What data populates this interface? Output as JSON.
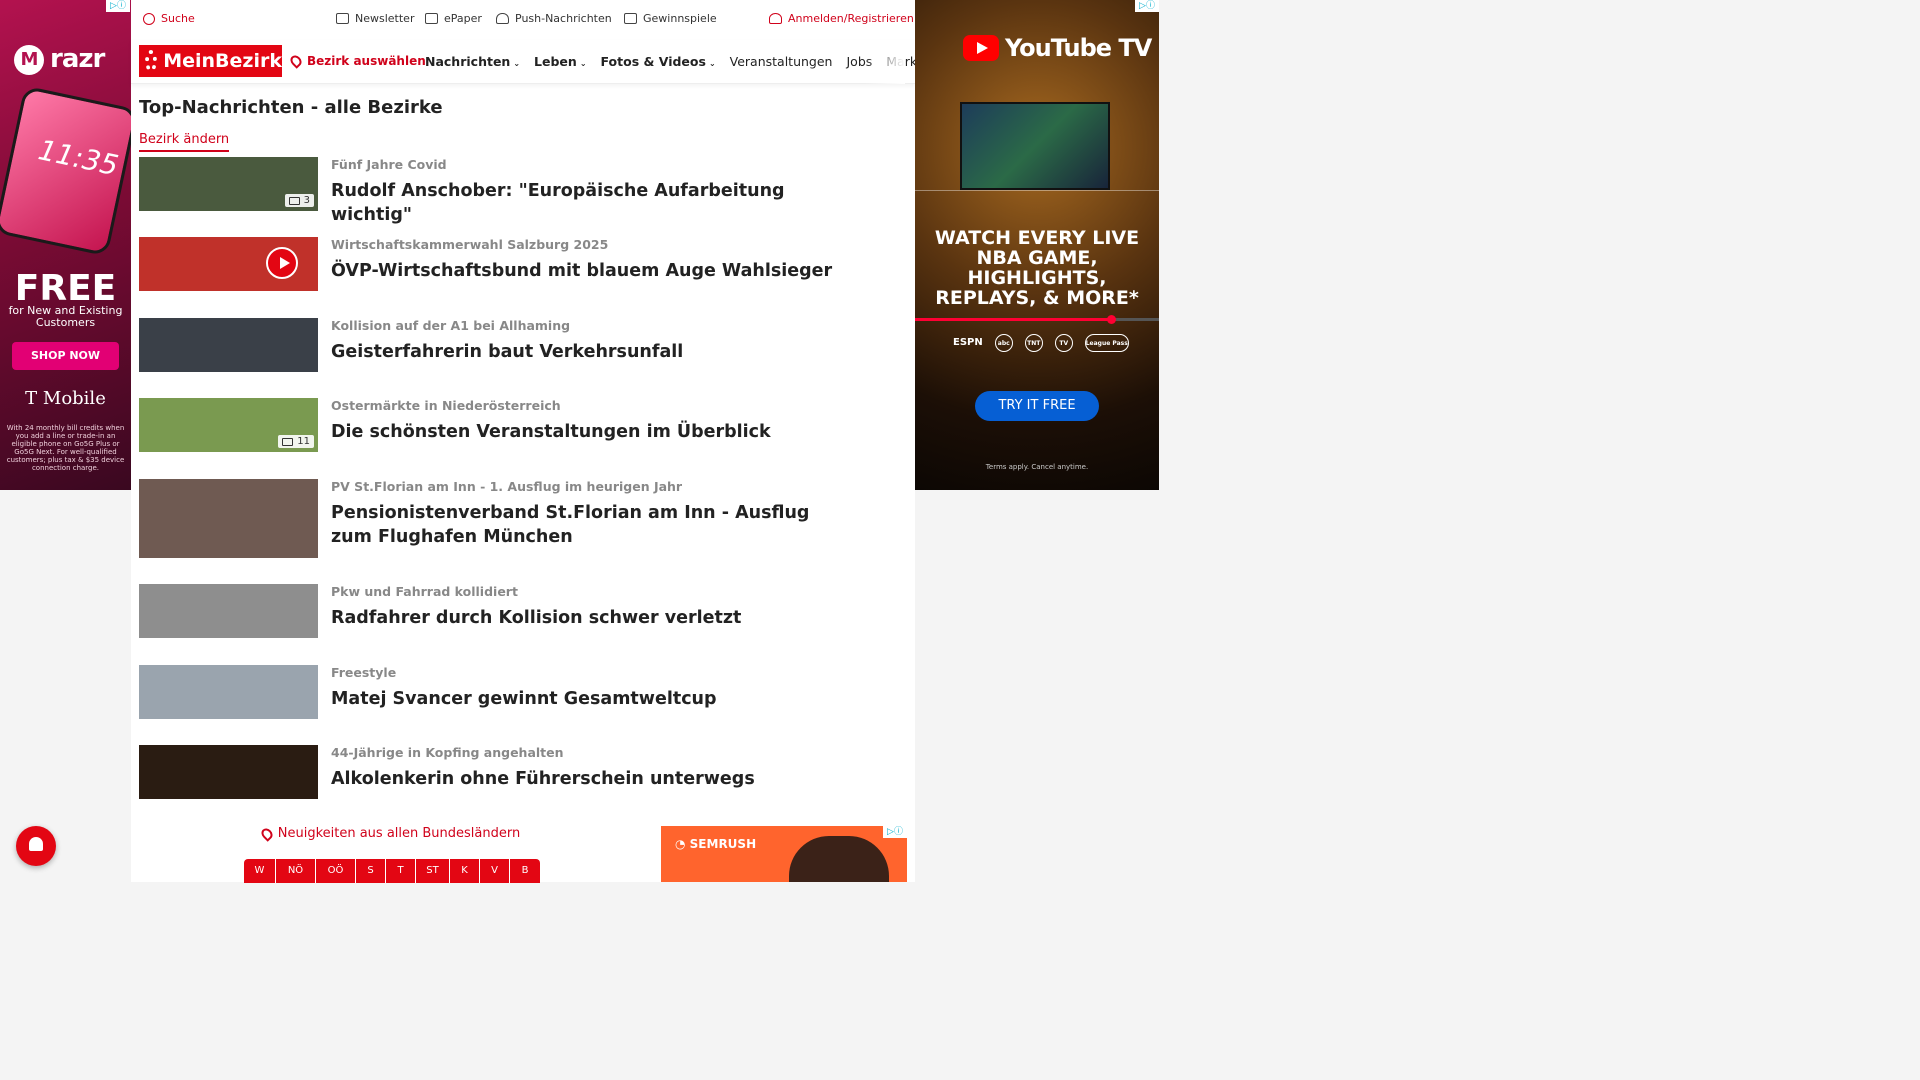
{
  "topbar": {
    "search": "Suche",
    "newsletter": "Newsletter",
    "epaper": "ePaper",
    "push": "Push-Nachrichten",
    "games": "Gewinnspiele",
    "login": "Anmelden/Registrieren"
  },
  "nav": {
    "logo": "MeinBezirk",
    "bezirk": "Bezirk auswählen",
    "links": [
      {
        "label": "Nachrichten",
        "dropdown": true
      },
      {
        "label": "Leben",
        "dropdown": true
      },
      {
        "label": "Fotos & Videos",
        "dropdown": true
      },
      {
        "label": "Veranstaltungen",
        "dropdown": false
      },
      {
        "label": "Jobs",
        "dropdown": false
      },
      {
        "label": "Marktplatz",
        "dropdown": false
      }
    ]
  },
  "main": {
    "heading": "Top-Nachrichten - alle Bezirke",
    "change_link": "Bezirk ändern",
    "articles": [
      {
        "overline": "Fünf Jahre Covid",
        "title": "Rudolf Anschober: \"Europäische Aufarbeitung wichtig\"",
        "media": "gallery",
        "count": "3",
        "thumb_color": "#4a5a3e"
      },
      {
        "overline": "Wirtschaftskammerwahl Salzburg 2025",
        "title": "ÖVP-Wirtschaftsbund mit blauem Auge Wahlsieger",
        "media": "video",
        "count": "",
        "thumb_color": "#c0312a"
      },
      {
        "overline": "Kollision auf der A1 bei Allhaming",
        "title": "Geisterfahrerin baut Verkehrsunfall",
        "media": "none",
        "count": "",
        "thumb_color": "#3a4048"
      },
      {
        "overline": "Ostermärkte in Niederösterreich",
        "title": "Die schönsten Veranstaltungen im Überblick",
        "media": "gallery",
        "count": "11",
        "thumb_color": "#7a9a50"
      },
      {
        "overline": "PV St.Florian am Inn - 1. Ausflug im heurigen Jahr",
        "title": "Pensionistenverband St.Florian am Inn - Ausflug zum Flughafen München",
        "media": "none",
        "count": "",
        "thumb_color": "#6f5a52"
      },
      {
        "overline": "Pkw und Fahrrad kollidiert",
        "title": "Radfahrer durch Kollision schwer verletzt",
        "media": "none",
        "count": "",
        "thumb_color": "#8e8e8e"
      },
      {
        "overline": "Freestyle",
        "title": "Matej Svancer gewinnt Gesamtweltcup",
        "media": "none",
        "count": "",
        "thumb_color": "#9aa4ae"
      },
      {
        "overline": "44-Jährige in Kopfing angehalten",
        "title": "Alkolenkerin ohne Führerschein unterwegs",
        "media": "none",
        "count": "",
        "thumb_color": "#2a1c12"
      }
    ],
    "bundeslaender_label": "Neuigkeiten aus allen Bundesländern",
    "states": [
      "W",
      "NÖ",
      "OÖ",
      "S",
      "T",
      "ST",
      "K",
      "V",
      "B"
    ]
  },
  "ads": {
    "left": {
      "brand": "razr",
      "time": "11:35",
      "free": "FREE",
      "sub": "for New and Existing Customers",
      "cta": "SHOP NOW",
      "carrier": "T Mobile",
      "fine": "With 24 monthly bill credits when you add a line or trade-in an eligible phone on Go5G Plus or Go5G Next. For well-qualified customers; plus tax & $35 device connection charge."
    },
    "right": {
      "brand": "YouTube TV",
      "headline": "WATCH EVERY LIVE NBA GAME, HIGHLIGHTS, REPLAYS, & MORE*",
      "networks": [
        "ESPN",
        "abc",
        "TNT",
        "TV",
        "League Pass"
      ],
      "cta": "TRY IT FREE",
      "terms": "Terms apply. Cancel anytime."
    },
    "bottom": {
      "brand": "SEMRUSH"
    }
  },
  "colors": {
    "brand_red": "#e30613",
    "link_red": "#d0021b"
  }
}
